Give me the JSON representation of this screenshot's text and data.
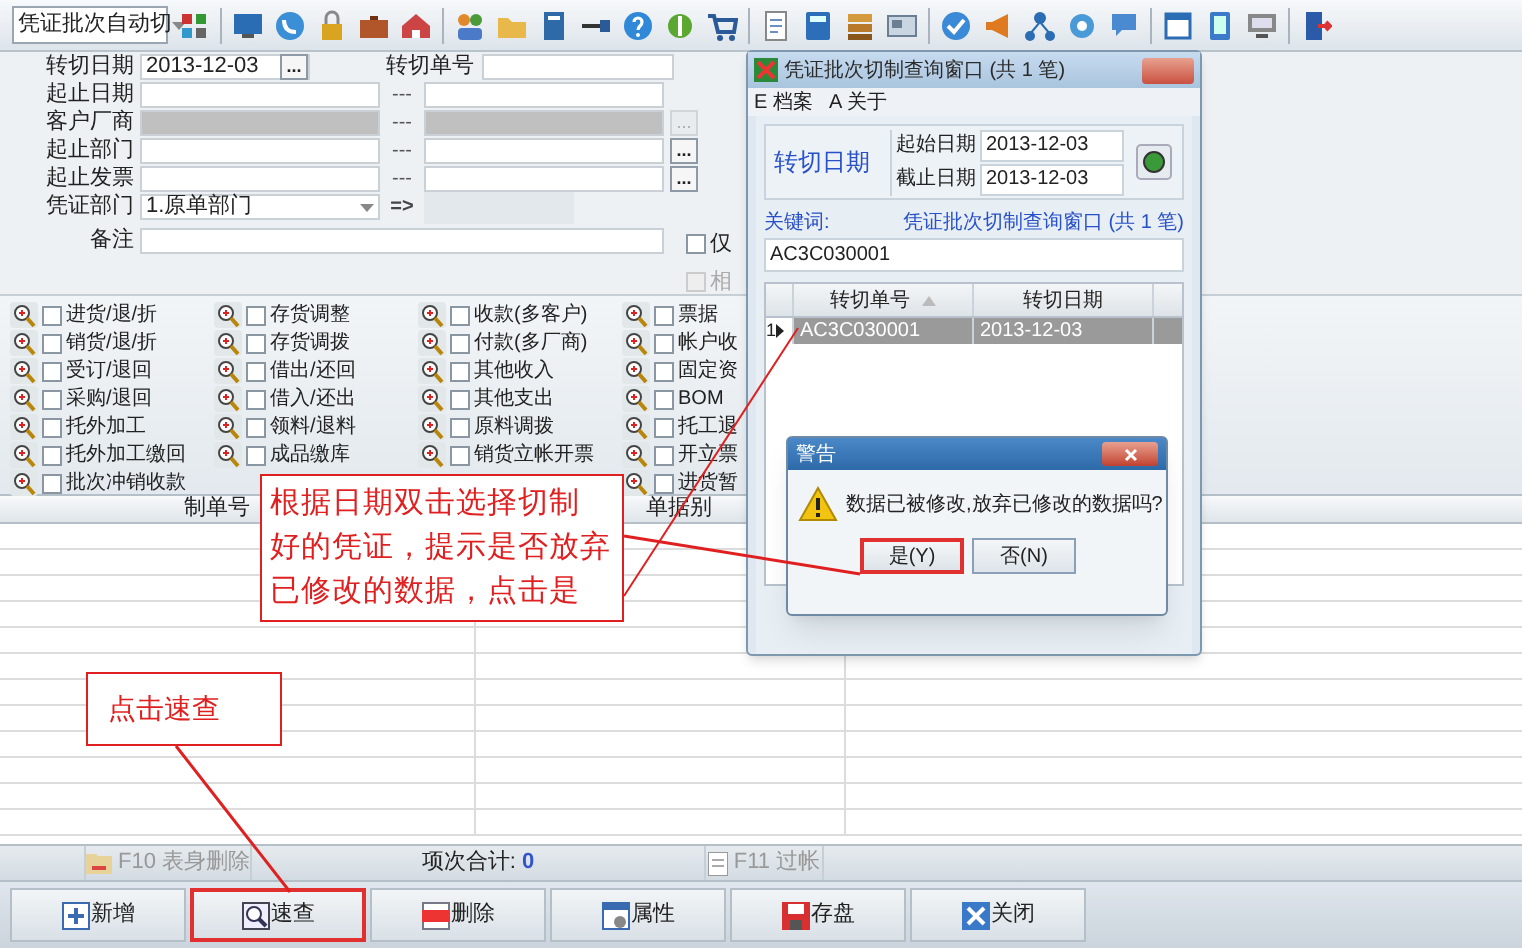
{
  "toolbar": {
    "combo": "凭证批次自动切"
  },
  "form": {
    "transfer_date": {
      "label": "转切日期",
      "value": "2013-12-03",
      "button": "..."
    },
    "transfer_no": {
      "label": "转切单号"
    },
    "ranges": [
      {
        "label": "起止日期",
        "separator": "---",
        "disabled": false
      },
      {
        "label": "客户厂商",
        "separator": "---",
        "disabled": true,
        "button": "..."
      },
      {
        "label": "起止部门",
        "separator": "---",
        "disabled": false,
        "button": "..."
      },
      {
        "label": "起止发票",
        "separator": "---",
        "disabled": false,
        "button": "..."
      }
    ],
    "voucher_dept": {
      "label": "凭证部门",
      "value": "1.原单部门",
      "arrow": "=>"
    },
    "remark": {
      "label": "备注"
    },
    "options": [
      {
        "label": "仅",
        "checked": false,
        "disabled": false
      },
      {
        "label": "相",
        "checked": false,
        "disabled": true
      }
    ]
  },
  "quick_items": [
    {
      "items": [
        {
          "label": "进货/退/折",
          "checked": false
        },
        {
          "label": "销货/退/折",
          "checked": false
        },
        {
          "label": "受订/退回",
          "checked": false
        },
        {
          "label": "采购/退回",
          "checked": false
        },
        {
          "label": "托外加工",
          "checked": false
        },
        {
          "label": "托外加工缴回",
          "checked": false
        },
        {
          "label": "批次冲销收款",
          "checked": false
        }
      ]
    },
    {
      "items": [
        {
          "label": "存货调整",
          "checked": false
        },
        {
          "label": "存货调拨",
          "checked": false
        },
        {
          "label": "借出/还回",
          "checked": false
        },
        {
          "label": "借入/还出",
          "checked": false
        },
        {
          "label": "领料/退料",
          "checked": false
        },
        {
          "label": "成品缴库",
          "checked": false
        }
      ]
    },
    {
      "items": [
        {
          "label": "收款(多客户)",
          "checked": false
        },
        {
          "label": "付款(多厂商)",
          "checked": false
        },
        {
          "label": "其他收入",
          "checked": false
        },
        {
          "label": "其他支出",
          "checked": false
        },
        {
          "label": "原料调拨",
          "checked": false
        },
        {
          "label": "销货立帐开票",
          "checked": false
        }
      ]
    },
    {
      "items": [
        {
          "label": "票据",
          "checked": false
        },
        {
          "label": "帐户收",
          "checked": false
        },
        {
          "label": "固定资",
          "checked": false
        },
        {
          "label": "BOM",
          "checked": false
        },
        {
          "label": "托工退",
          "checked": false
        },
        {
          "label": "开立票",
          "checked": false
        },
        {
          "label": "进货暂",
          "checked": false
        }
      ]
    }
  ],
  "table": {
    "columns": [
      "制单号",
      "单据别"
    ]
  },
  "status_bar": {
    "delete_row": {
      "label": "F10 表身删除",
      "disabled": true
    },
    "total_label": "项次合计:",
    "total": "0",
    "post": {
      "label": "F11 过帐",
      "disabled": true
    }
  },
  "buttons": [
    {
      "label": "新增",
      "kind": "add",
      "highlighted": false
    },
    {
      "label": "速查",
      "kind": "search",
      "highlighted": true
    },
    {
      "label": "删除",
      "kind": "delete",
      "highlighted": false
    },
    {
      "label": "属性",
      "kind": "properties",
      "highlighted": false
    },
    {
      "label": "存盘",
      "kind": "save",
      "highlighted": false
    },
    {
      "label": "关闭",
      "kind": "close",
      "highlighted": false
    }
  ],
  "query_window": {
    "title": "凭证批次切制查询窗口 (共 1 笔)",
    "menu": [
      "E 档案",
      "A 关于"
    ],
    "date_group": "转切日期",
    "start": {
      "label": "起始日期",
      "value": "2013-12-03"
    },
    "end": {
      "label": "截止日期",
      "value": "2013-12-03"
    },
    "keyword_label": "关键词:",
    "summary": "凭证批次切制查询窗口 (共 1 笔)",
    "keyword": "AC3C030001",
    "columns": [
      "转切单号",
      "转切日期"
    ],
    "rows": [
      {
        "index": "1",
        "cells": [
          "AC3C030001",
          "2013-12-03"
        ],
        "selected": true
      }
    ]
  },
  "warning": {
    "title": "警告",
    "message": "数据已被修改,放弃已修改的数据吗?",
    "buttons": [
      {
        "label": "是(Y)",
        "highlighted": true
      },
      {
        "label": "否(N)",
        "highlighted": false
      }
    ]
  },
  "annotations": [
    {
      "lines": [
        "根据日期双击选择切制",
        "好的凭证，提示是否放弃",
        "已修改的数据，点击是"
      ]
    },
    {
      "lines": [
        "点击速查"
      ]
    }
  ]
}
